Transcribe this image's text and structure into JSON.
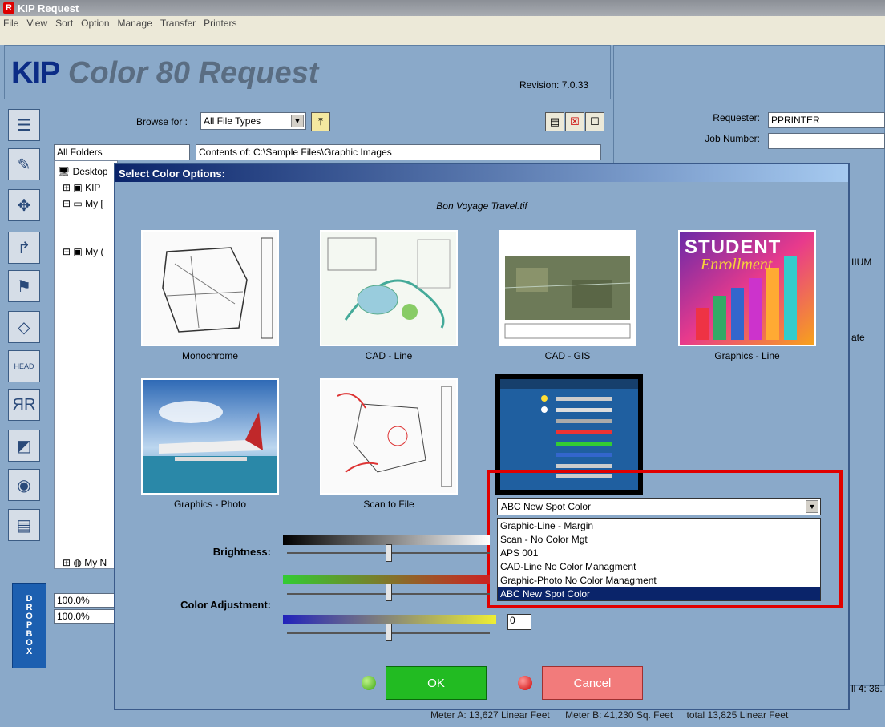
{
  "window": {
    "title": "KIP Request",
    "icon_letter": "R"
  },
  "menu": [
    "File",
    "View",
    "Sort",
    "Option",
    "Manage",
    "Transfer",
    "Printers"
  ],
  "header": {
    "logo_kip": "KIP",
    "logo_rest": "Color 80 Request",
    "revision": "Revision: 7.0.33"
  },
  "browse": {
    "label": "Browse for :",
    "file_type": "All File Types",
    "folders_label": "All Folders",
    "contents": "Contents of: C:\\Sample Files\\Graphic Images"
  },
  "tree": {
    "items": [
      "Desktop",
      "KIP",
      "My [",
      "My (",
      "My N"
    ]
  },
  "left_values": [
    "100.0%",
    "100.0%"
  ],
  "dropbox_label": [
    "D",
    "R",
    "O",
    "P",
    "B",
    "O",
    "X"
  ],
  "requester": {
    "requester_label": "Requester:",
    "requester_value": "PPRINTER",
    "job_label": "Job Number:",
    "partial1": "IIUM",
    "partial2": "ate",
    "partial3": "ll 4: 36."
  },
  "dialog": {
    "title": "Select Color Options:",
    "filename": "Bon Voyage Travel.tif",
    "thumbnails": [
      {
        "label": "Monochrome"
      },
      {
        "label": "CAD - Line"
      },
      {
        "label": "CAD - GIS"
      },
      {
        "label": "Graphics - Line"
      },
      {
        "label": "Graphics - Photo"
      },
      {
        "label": "Scan to File"
      }
    ],
    "student_title": "STUDENT",
    "student_sub": "Enrollment",
    "brightness_label": "Brightness:",
    "color_adj_label": "Color Adjustment:",
    "slider_value": "0",
    "combo_value": "ABC New Spot Color",
    "dropdown_options": [
      "Graphic-Line - Margin",
      "Scan - No Color Mgt",
      "APS 001",
      "CAD-Line No Color Managment",
      "Graphic-Photo No Color Managment",
      "ABC New Spot Color"
    ],
    "ok_label": "OK",
    "cancel_label": "Cancel"
  },
  "status": {
    "meter_a": "Meter A: 13,627 Linear Feet",
    "meter_b": "Meter B: 41,230 Sq. Feet",
    "total": "total 13,825 Linear Feet"
  }
}
